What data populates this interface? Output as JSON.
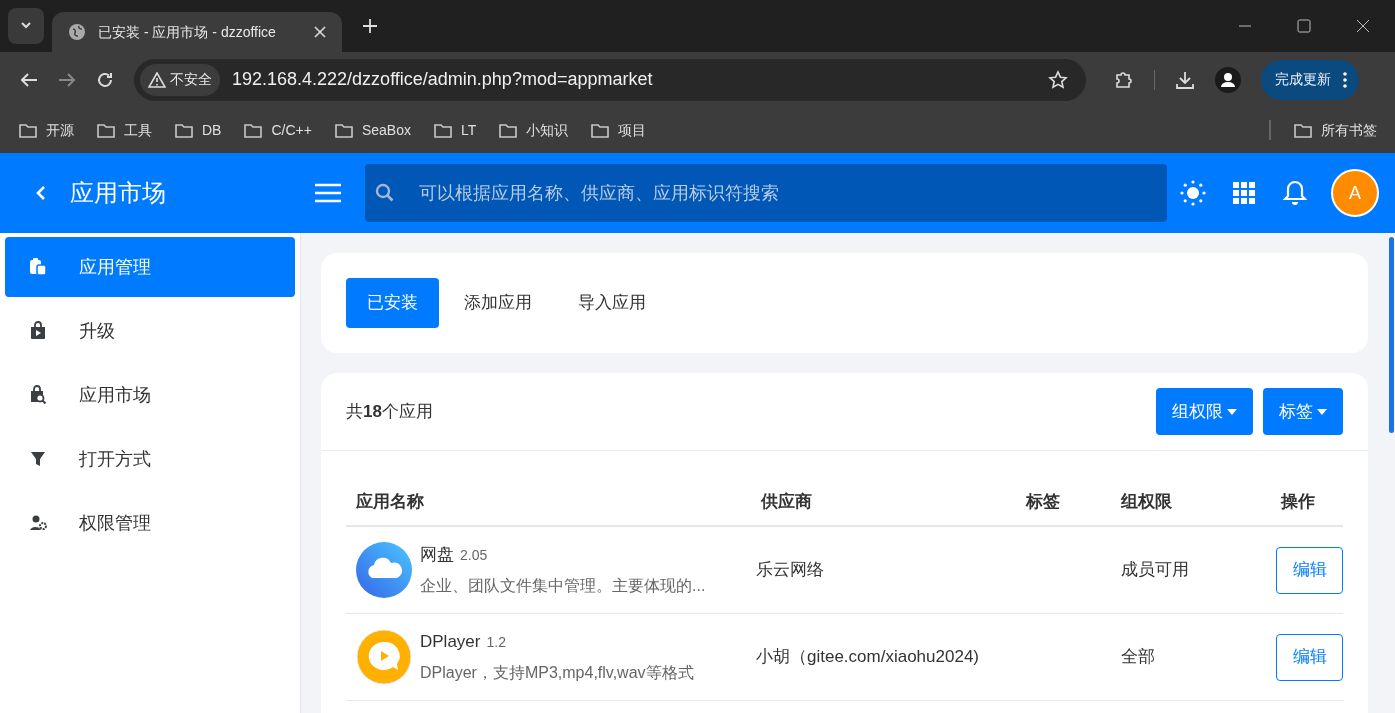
{
  "browser": {
    "tab_title": "已安装 - 应用市场 - dzzoffice",
    "security": "不安全",
    "url": "192.168.4.222/dzzoffice/admin.php?mod=appmarket",
    "update_button": "完成更新",
    "bookmarks": [
      "开源",
      "工具",
      "DB",
      "C/C++",
      "SeaBox",
      "LT",
      "小知识",
      "项目"
    ],
    "all_bookmarks": "所有书签"
  },
  "header": {
    "title": "应用市场",
    "search": {
      "placeholder": "可以根据应用名称、供应商、应用标识符搜索"
    },
    "avatar": "A"
  },
  "sidebar": {
    "items": [
      {
        "label": "应用管理",
        "selected": true
      },
      {
        "label": "升级",
        "selected": false
      },
      {
        "label": "应用市场",
        "selected": false
      },
      {
        "label": "打开方式",
        "selected": false
      },
      {
        "label": "权限管理",
        "selected": false
      }
    ]
  },
  "tabs": [
    {
      "label": "已安装",
      "selected": true
    },
    {
      "label": "添加应用",
      "selected": false
    },
    {
      "label": "导入应用",
      "selected": false
    }
  ],
  "summary": "共**18**个应用",
  "filters": [
    "组权限",
    "标签"
  ],
  "table": {
    "columns": [
      "应用名称",
      "供应商",
      "标签",
      "组权限",
      "操作"
    ],
    "rows": [
      {
        "name": "网盘",
        "version": "2.05",
        "description": "企业、团队文件集中管理。主要体现的...",
        "vendor": "乐云网络",
        "permission": "成员可用",
        "action": "编辑"
      },
      {
        "name": "DPlayer",
        "version": "1.2",
        "description": "DPlayer，支持MP3,mp4,flv,wav等格式",
        "vendor": "小胡（gitee.com/xiaohu2024)",
        "permission": "全部",
        "action": "编辑"
      }
    ]
  }
}
